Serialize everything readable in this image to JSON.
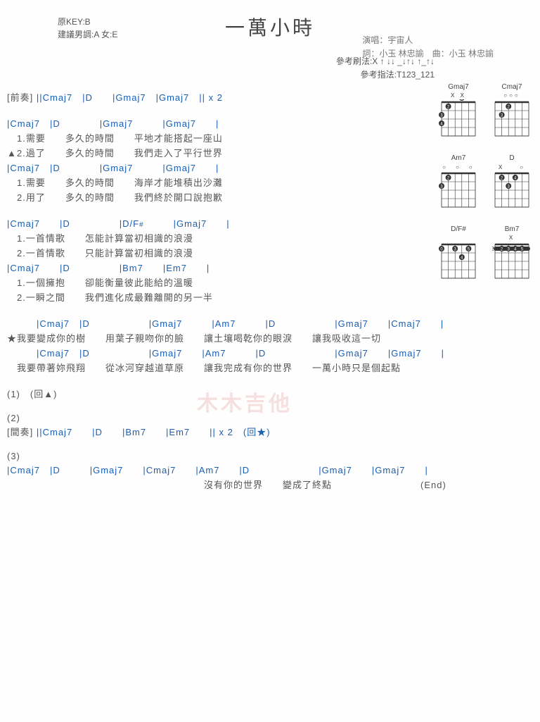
{
  "header": {
    "original_key": "原KEY:B",
    "suggested": "建議男調:A 女:E",
    "title": "一萬小時",
    "singer_label": "演唱：宇宙人",
    "credits": "詞：小玉 林忠諭　曲：小玉 林忠諭",
    "strum_label": "參考刷法:X ↑ ↓↓ _↓↑↓ ↑_↑↓",
    "finger_label": "參考指法:T123_121"
  },
  "intro": {
    "label": "[前奏]",
    "chords": "||Cmaj7　|D　　|Gmaj7　|Gmaj7　|| x 2"
  },
  "verse1": {
    "chord_line1": "|Cmaj7　|D　　　　|Gmaj7　　　|Gmaj7　　|",
    "lyr1a": "　1.需要　　多久的時間　　平地才能搭起一座山",
    "lyr1b": "▲2.過了　　多久的時間　　我們走入了平行世界",
    "chord_line2": "|Cmaj7　|D　　　　|Gmaj7　　　|Gmaj7　　|",
    "lyr2a": "　1.需要　　多久的時間　　海岸才能堆積出沙灘",
    "lyr2b": "　2.用了　　多久的時間　　我們終於開口說抱歉"
  },
  "verse2": {
    "chord_line1": "|Cmaj7　　|D　　　　　|D/F#　　　|Gmaj7　　|",
    "lyr1a": "　1.一首情歌　　怎能計算當初相識的浪漫",
    "lyr1b": "　2.一首情歌　　只能計算當初相識的浪漫",
    "chord_line2": "|Cmaj7　　|D　　　　　|Bm7　　|Em7　　|",
    "lyr2a": "　1.一個擁抱　　卻能衡量彼此能給的溫暖",
    "lyr2b": "　2.一瞬之間　　我們進化成最難離開的另一半"
  },
  "chorus": {
    "chord_line1": "　　　|Cmaj7　|D　　　　　　|Gmaj7　　　|Am7　　　|D　　　　　　|Gmaj7　　|Cmaj7　　|",
    "lyr1": "★我要變成你的樹　　用葉子親吻你的臉　　讓土壤喝乾你的眼淚　　讓我吸收這一切",
    "chord_line2": "　　　|Cmaj7　|D　　　　　　|Gmaj7　　|Am7　　　|D　　　　　　　|Gmaj7　　|Gmaj7　　|",
    "lyr2": "　我要帶著妳飛翔　　從冰河穿越道草原　　讓我完成有你的世界　　一萬小時只是個起點"
  },
  "direction1": "(1)　(回▲)",
  "direction2_label": "(2)",
  "interlude": {
    "label": "[間奏]",
    "chords": "||Cmaj7　　|D　　|Bm7　　|Em7　　|| x 2　(回★)"
  },
  "direction3_label": "(3)",
  "ending": {
    "chord_line": "|Cmaj7　|D　　　|Gmaj7　　|Cmaj7　　|Am7　　|D　　　　　　　|Gmaj7　　|Gmaj7　　|",
    "lyr": "　　　　　　　　　　　　　　　　　　　　沒有你的世界　　變成了終點　　　　　　　　　(End)"
  },
  "diagrams": [
    {
      "name": "Gmaj7",
      "top": "X X"
    },
    {
      "name": "Cmaj7",
      "top": "○○○"
    },
    {
      "name": "Am7",
      "top": "○　○　○"
    },
    {
      "name": "D",
      "top": "X　　○"
    },
    {
      "name": "D/F#",
      "top": ""
    },
    {
      "name": "Bm7",
      "top": "X"
    }
  ],
  "watermark": "木木吉他"
}
